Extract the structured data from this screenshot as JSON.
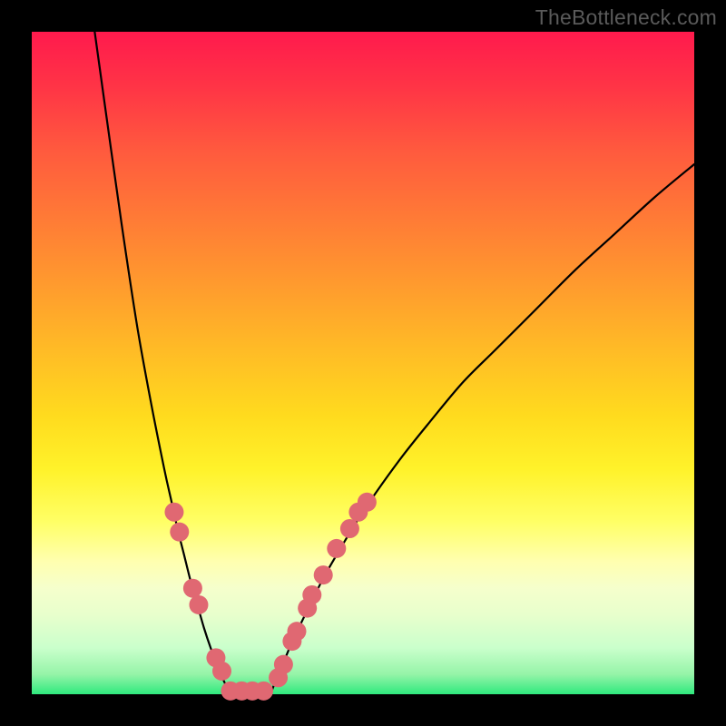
{
  "watermark": "TheBottleneck.com",
  "colors": {
    "page_background": "#000000",
    "curve": "#000000",
    "marker": "#e06872",
    "gradient_top": "#ff1a4d",
    "gradient_bottom": "#2fe97d"
  },
  "chart_data": {
    "type": "line",
    "title": "",
    "xlabel": "",
    "ylabel": "",
    "xlim": [
      0,
      100
    ],
    "ylim": [
      0,
      100
    ],
    "grid": false,
    "legend": false,
    "description": "V-shaped bottleneck curve on a vertical heat gradient. Two black arcs descend from the upper corners; the left (steep) curve reaches the floor near x≈30, the right (shallow) curve near x≈36. Pink circular markers sit along both curves near the trough.",
    "series": [
      {
        "name": "left-curve",
        "x": [
          9.5,
          12,
          14,
          16,
          18,
          20,
          21,
          22,
          23,
          24,
          25,
          26,
          27,
          28,
          29,
          30
        ],
        "y": [
          100,
          82,
          68,
          55,
          44,
          34,
          29.5,
          25,
          21,
          17,
          13.5,
          10,
          7,
          4.4,
          2,
          0
        ]
      },
      {
        "name": "right-curve",
        "x": [
          36,
          37,
          38,
          39,
          40,
          42,
          44,
          46,
          49,
          52,
          56,
          60,
          65,
          70,
          76,
          82,
          88,
          94,
          100
        ],
        "y": [
          0,
          2.4,
          4.8,
          7.2,
          9.4,
          13.5,
          17.5,
          21,
          26,
          30.5,
          36,
          41,
          47,
          52,
          58,
          64,
          69.5,
          75,
          80
        ]
      }
    ],
    "markers": [
      {
        "curve": "left",
        "x": 21.5,
        "y": 27.5
      },
      {
        "curve": "left",
        "x": 22.3,
        "y": 24.5
      },
      {
        "curve": "left",
        "x": 24.3,
        "y": 16
      },
      {
        "curve": "left",
        "x": 25.2,
        "y": 13.5
      },
      {
        "curve": "left",
        "x": 27.8,
        "y": 5.5
      },
      {
        "curve": "left",
        "x": 28.7,
        "y": 3.5
      },
      {
        "curve": "floor",
        "x": 30.0,
        "y": 0.5
      },
      {
        "curve": "floor",
        "x": 31.7,
        "y": 0.5
      },
      {
        "curve": "floor",
        "x": 33.3,
        "y": 0.5
      },
      {
        "curve": "floor",
        "x": 35.0,
        "y": 0.5
      },
      {
        "curve": "right",
        "x": 37.2,
        "y": 2.5
      },
      {
        "curve": "right",
        "x": 38.0,
        "y": 4.5
      },
      {
        "curve": "right",
        "x": 39.3,
        "y": 8
      },
      {
        "curve": "right",
        "x": 40.0,
        "y": 9.5
      },
      {
        "curve": "right",
        "x": 41.6,
        "y": 13
      },
      {
        "curve": "right",
        "x": 42.3,
        "y": 15
      },
      {
        "curve": "right",
        "x": 44.0,
        "y": 18
      },
      {
        "curve": "right",
        "x": 46.0,
        "y": 22
      },
      {
        "curve": "right",
        "x": 48.0,
        "y": 25
      },
      {
        "curve": "right",
        "x": 49.3,
        "y": 27.5
      },
      {
        "curve": "right",
        "x": 50.6,
        "y": 29
      }
    ],
    "marker_radius_px": 10.5
  }
}
